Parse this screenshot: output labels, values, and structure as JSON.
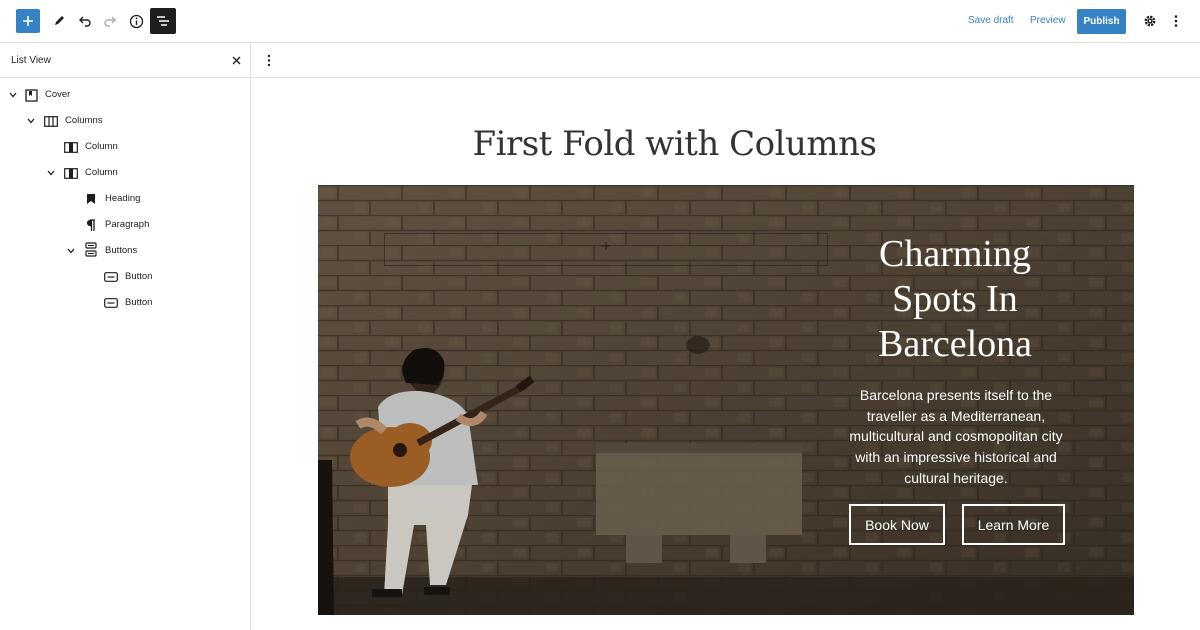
{
  "toolbar": {
    "add_icon": "plus-icon",
    "tools_icon": "pencil-icon",
    "undo_icon": "undo-icon",
    "redo_icon": "redo-icon",
    "details_icon": "info-icon",
    "listview_icon": "list-view-icon",
    "save_draft": "Save draft",
    "preview": "Preview",
    "publish": "Publish",
    "settings_icon": "gear-icon",
    "more_icon": "kebab-icon",
    "accent": "#3582c4"
  },
  "sidebar": {
    "title": "List View",
    "close_icon": "close-icon",
    "items": [
      {
        "label": "Cover",
        "icon": "cover-icon",
        "expanded": true
      },
      {
        "label": "Columns",
        "icon": "columns-icon",
        "expanded": true
      },
      {
        "label": "Column",
        "icon": "column-icon",
        "expanded": false
      },
      {
        "label": "Column",
        "icon": "column-icon",
        "expanded": true
      },
      {
        "label": "Heading",
        "icon": "bookmark-icon",
        "expanded": false
      },
      {
        "label": "Paragraph",
        "icon": "pilcrow-icon",
        "expanded": false
      },
      {
        "label": "Buttons",
        "icon": "buttons-icon",
        "expanded": true
      },
      {
        "label": "Button",
        "icon": "button-icon",
        "expanded": false
      },
      {
        "label": "Button",
        "icon": "button-icon",
        "expanded": false
      }
    ]
  },
  "editor": {
    "options_icon": "kebab-icon",
    "page_title": "First Fold with Columns",
    "cover": {
      "heading": "Charming Spots In Barcelona",
      "paragraph": "Barcelona presents itself to the traveller as a Mediterranean, multicultural and cosmopolitan city with an impressive historical and cultural heritage.",
      "button_primary": "Book Now",
      "button_secondary": "Learn More",
      "placeholder_icon": "plus-icon"
    }
  }
}
